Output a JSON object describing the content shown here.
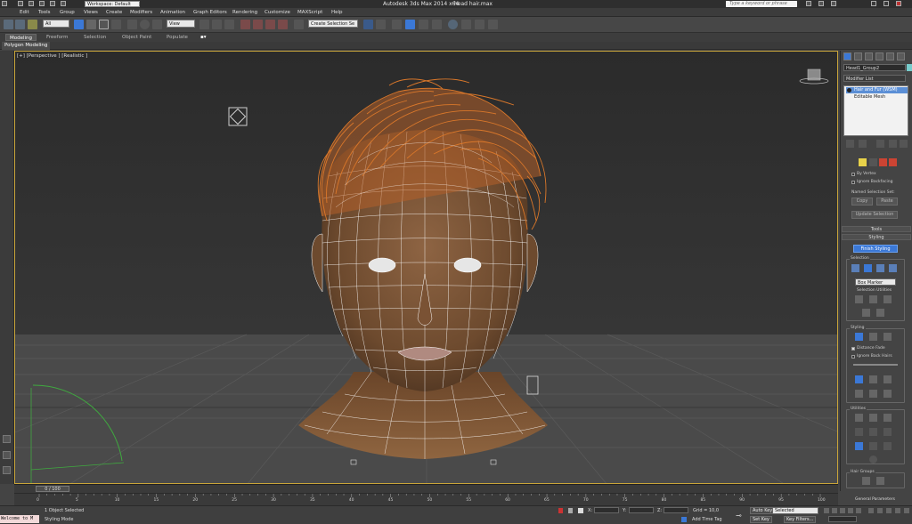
{
  "app": {
    "title": "Autodesk 3ds Max  2014 x64",
    "file": "head hair.max",
    "workspace": "Workspace: Default",
    "search_placeholder": "Type a keyword or phrase"
  },
  "menu": [
    "Edit",
    "Tools",
    "Group",
    "Views",
    "Create",
    "Modifiers",
    "Animation",
    "Graph Editors",
    "Rendering",
    "Customize",
    "MAXScript",
    "Help"
  ],
  "toolbar": {
    "selection_filter": "All",
    "reference_coord": "View",
    "named_selection": "Create Selection Se"
  },
  "ribbon": {
    "tabs": [
      "Modeling",
      "Freeform",
      "Selection",
      "Object Paint",
      "Populate"
    ],
    "active_tab": "Modeling",
    "sub_tab": "Polygon Modeling"
  },
  "viewport": {
    "label": "[+] [Perspective ] [Realistic ]"
  },
  "command_panel": {
    "object_name": "Head1_Group2",
    "modifier_list": "Modifier List",
    "stack": [
      "Hair and Fur (WSM)",
      "Editable Mesh"
    ],
    "selection_options": [
      "By Vertex",
      "Ignore Backfacing"
    ],
    "named_selection_set_label": "Named Selection Set:",
    "copy_label": "Copy",
    "paste_label": "Paste",
    "update_selection_label": "Update Selection",
    "tools_label": "Tools",
    "styling_label": "Styling",
    "finish_styling_label": "Finish Styling",
    "selection_group": "Selection",
    "box_marker": "Box Marker",
    "selection_utilities": "Selection Utilities",
    "styling_group": "Styling",
    "distance_fade": "Distance Fade",
    "ignore_back_hairs": "Ignore Back Hairs",
    "utilities_group": "Utilities",
    "hair_groups_group": "Hair Groups",
    "general_parameters": "General Parameters"
  },
  "timeline": {
    "frame_display": "0 / 100",
    "current_frame": 0,
    "total_frames": 100,
    "ticks": [
      "0",
      "5",
      "10",
      "15",
      "20",
      "25",
      "30",
      "35",
      "40",
      "45",
      "50",
      "55",
      "60",
      "65",
      "70",
      "75",
      "80",
      "85",
      "90",
      "95",
      "100"
    ]
  },
  "status": {
    "maxscript": "Welcome to M",
    "objects_selected": "1 Object Selected",
    "prompt": "Styling Mode",
    "x_label": "X:",
    "y_label": "Y:",
    "z_label": "Z:",
    "grid": "Grid = 10,0",
    "add_time_tag": "Add Time Tag",
    "auto_key": "Auto Key",
    "set_key": "Set Key",
    "selected_dropdown": "Selected",
    "key_filters": "Key Filters..."
  },
  "colors": {
    "viewport_border": "#c9a53a",
    "active_blue": "#3b78d6",
    "hair": "#d9772a",
    "wire": "#ffffff",
    "skin": "#8a5a35"
  }
}
